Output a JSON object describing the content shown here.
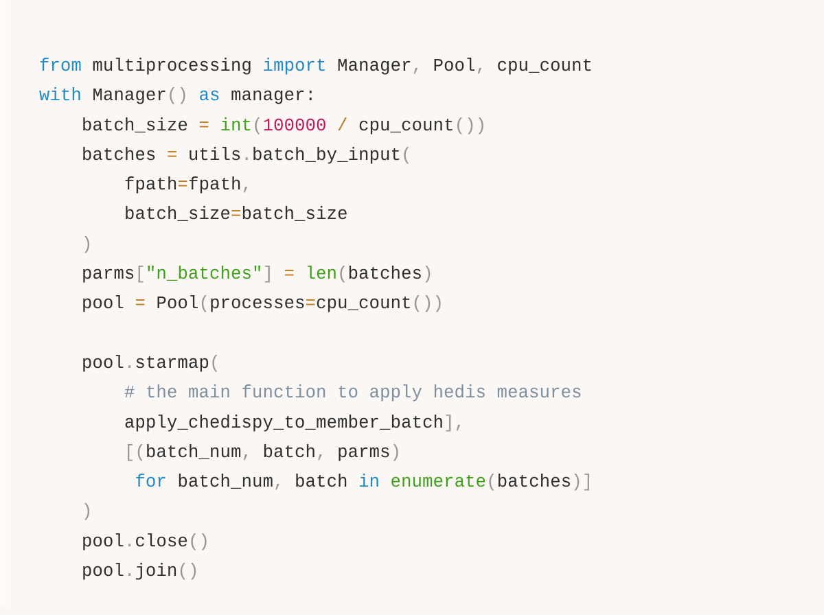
{
  "document": {
    "kind": "code-snippet",
    "language": "Python",
    "background_color": "#faf7f4",
    "palette": {
      "keyword": "#1e8bc8",
      "builtin": "#3fa11a",
      "string": "#3fa11a",
      "number": "#c2185b",
      "operator": "#c07818",
      "punctuation": "#9b948d",
      "comment": "#7d8fa0",
      "text": "#2e2e2e"
    }
  },
  "code": {
    "plain_text": "from multiprocessing import Manager, Pool, cpu_count\nwith Manager() as manager:\n    batch_size = int(100000 / cpu_count())\n    batches = utils.batch_by_input(\n        fpath=fpath,\n        batch_size=batch_size\n    )\n    parms[\"n_batches\"] = len(batches)\n    pool = Pool(processes=cpu_count())\n\n    pool.starmap(\n        # the main function to apply hedis measures\n        apply_chedispy_to_member_batch],\n        [(batch_num, batch, parms)\n         for batch_num, batch in enumerate(batches)]\n    )\n    pool.close()\n    pool.join()",
    "lines": [
      {
        "n": 1,
        "text": "from multiprocessing import Manager, Pool, cpu_count",
        "tokens": [
          {
            "t": "from",
            "c": "kw"
          },
          {
            "t": " multiprocessing ",
            "c": "txt"
          },
          {
            "t": "import",
            "c": "kw"
          },
          {
            "t": " Manager",
            "c": "txt"
          },
          {
            "t": ",",
            "c": "pun"
          },
          {
            "t": " Pool",
            "c": "txt"
          },
          {
            "t": ",",
            "c": "pun"
          },
          {
            "t": " cpu_count",
            "c": "txt"
          }
        ]
      },
      {
        "n": 2,
        "text": "with Manager() as manager:",
        "tokens": [
          {
            "t": "with",
            "c": "kw"
          },
          {
            "t": " Manager",
            "c": "txt"
          },
          {
            "t": "()",
            "c": "pun"
          },
          {
            "t": " ",
            "c": "txt"
          },
          {
            "t": "as",
            "c": "kw"
          },
          {
            "t": " manager:",
            "c": "txt"
          }
        ]
      },
      {
        "n": 3,
        "text": "    batch_size = int(100000 / cpu_count())",
        "tokens": [
          {
            "t": "    batch_size ",
            "c": "txt"
          },
          {
            "t": "=",
            "c": "op"
          },
          {
            "t": " ",
            "c": "txt"
          },
          {
            "t": "int",
            "c": "bi"
          },
          {
            "t": "(",
            "c": "pun"
          },
          {
            "t": "100000",
            "c": "num"
          },
          {
            "t": " ",
            "c": "txt"
          },
          {
            "t": "/",
            "c": "op"
          },
          {
            "t": " cpu_count",
            "c": "txt"
          },
          {
            "t": "())",
            "c": "pun"
          }
        ]
      },
      {
        "n": 4,
        "text": "    batches = utils.batch_by_input(",
        "tokens": [
          {
            "t": "    batches ",
            "c": "txt"
          },
          {
            "t": "=",
            "c": "op"
          },
          {
            "t": " utils",
            "c": "txt"
          },
          {
            "t": ".",
            "c": "pun"
          },
          {
            "t": "batch_by_input",
            "c": "txt"
          },
          {
            "t": "(",
            "c": "pun"
          }
        ]
      },
      {
        "n": 5,
        "text": "        fpath=fpath,",
        "tokens": [
          {
            "t": "        fpath",
            "c": "txt"
          },
          {
            "t": "=",
            "c": "op"
          },
          {
            "t": "fpath",
            "c": "txt"
          },
          {
            "t": ",",
            "c": "pun"
          }
        ]
      },
      {
        "n": 6,
        "text": "        batch_size=batch_size",
        "tokens": [
          {
            "t": "        batch_size",
            "c": "txt"
          },
          {
            "t": "=",
            "c": "op"
          },
          {
            "t": "batch_size",
            "c": "txt"
          }
        ]
      },
      {
        "n": 7,
        "text": "    )",
        "tokens": [
          {
            "t": "    ",
            "c": "txt"
          },
          {
            "t": ")",
            "c": "pun"
          }
        ]
      },
      {
        "n": 8,
        "text": "    parms[\"n_batches\"] = len(batches)",
        "tokens": [
          {
            "t": "    parms",
            "c": "txt"
          },
          {
            "t": "[",
            "c": "pun"
          },
          {
            "t": "\"n_batches\"",
            "c": "str"
          },
          {
            "t": "]",
            "c": "pun"
          },
          {
            "t": " ",
            "c": "txt"
          },
          {
            "t": "=",
            "c": "op"
          },
          {
            "t": " ",
            "c": "txt"
          },
          {
            "t": "len",
            "c": "bi"
          },
          {
            "t": "(",
            "c": "pun"
          },
          {
            "t": "batches",
            "c": "txt"
          },
          {
            "t": ")",
            "c": "pun"
          }
        ]
      },
      {
        "n": 9,
        "text": "    pool = Pool(processes=cpu_count())",
        "tokens": [
          {
            "t": "    pool ",
            "c": "txt"
          },
          {
            "t": "=",
            "c": "op"
          },
          {
            "t": " Pool",
            "c": "txt"
          },
          {
            "t": "(",
            "c": "pun"
          },
          {
            "t": "processes",
            "c": "txt"
          },
          {
            "t": "=",
            "c": "op"
          },
          {
            "t": "cpu_count",
            "c": "txt"
          },
          {
            "t": "())",
            "c": "pun"
          }
        ]
      },
      {
        "n": 10,
        "text": "",
        "tokens": []
      },
      {
        "n": 11,
        "text": "    pool.starmap(",
        "tokens": [
          {
            "t": "    pool",
            "c": "txt"
          },
          {
            "t": ".",
            "c": "pun"
          },
          {
            "t": "starmap",
            "c": "txt"
          },
          {
            "t": "(",
            "c": "pun"
          }
        ]
      },
      {
        "n": 12,
        "text": "        # the main function to apply hedis measures",
        "tokens": [
          {
            "t": "        ",
            "c": "txt"
          },
          {
            "t": "# the main function to apply hedis measures",
            "c": "cmt"
          }
        ]
      },
      {
        "n": 13,
        "text": "        apply_chedispy_to_member_batch],",
        "tokens": [
          {
            "t": "        apply_chedispy_to_member_batch",
            "c": "txt"
          },
          {
            "t": "],",
            "c": "pun"
          }
        ]
      },
      {
        "n": 14,
        "text": "        [(batch_num, batch, parms)",
        "tokens": [
          {
            "t": "        ",
            "c": "txt"
          },
          {
            "t": "[(",
            "c": "pun"
          },
          {
            "t": "batch_num",
            "c": "txt"
          },
          {
            "t": ",",
            "c": "pun"
          },
          {
            "t": " batch",
            "c": "txt"
          },
          {
            "t": ",",
            "c": "pun"
          },
          {
            "t": " parms",
            "c": "txt"
          },
          {
            "t": ")",
            "c": "pun"
          }
        ]
      },
      {
        "n": 15,
        "text": "         for batch_num, batch in enumerate(batches)]",
        "tokens": [
          {
            "t": "         ",
            "c": "txt"
          },
          {
            "t": "for",
            "c": "kw"
          },
          {
            "t": " batch_num",
            "c": "txt"
          },
          {
            "t": ",",
            "c": "pun"
          },
          {
            "t": " batch ",
            "c": "txt"
          },
          {
            "t": "in",
            "c": "kw"
          },
          {
            "t": " ",
            "c": "txt"
          },
          {
            "t": "enumerate",
            "c": "bi"
          },
          {
            "t": "(",
            "c": "pun"
          },
          {
            "t": "batches",
            "c": "txt"
          },
          {
            "t": ")]",
            "c": "pun"
          }
        ]
      },
      {
        "n": 16,
        "text": "    )",
        "tokens": [
          {
            "t": "    ",
            "c": "txt"
          },
          {
            "t": ")",
            "c": "pun"
          }
        ]
      },
      {
        "n": 17,
        "text": "    pool.close()",
        "tokens": [
          {
            "t": "    pool",
            "c": "txt"
          },
          {
            "t": ".",
            "c": "pun"
          },
          {
            "t": "close",
            "c": "txt"
          },
          {
            "t": "()",
            "c": "pun"
          }
        ]
      },
      {
        "n": 18,
        "text": "    pool.join()",
        "tokens": [
          {
            "t": "    pool",
            "c": "txt"
          },
          {
            "t": ".",
            "c": "pun"
          },
          {
            "t": "join",
            "c": "txt"
          },
          {
            "t": "()",
            "c": "pun"
          }
        ]
      }
    ]
  }
}
